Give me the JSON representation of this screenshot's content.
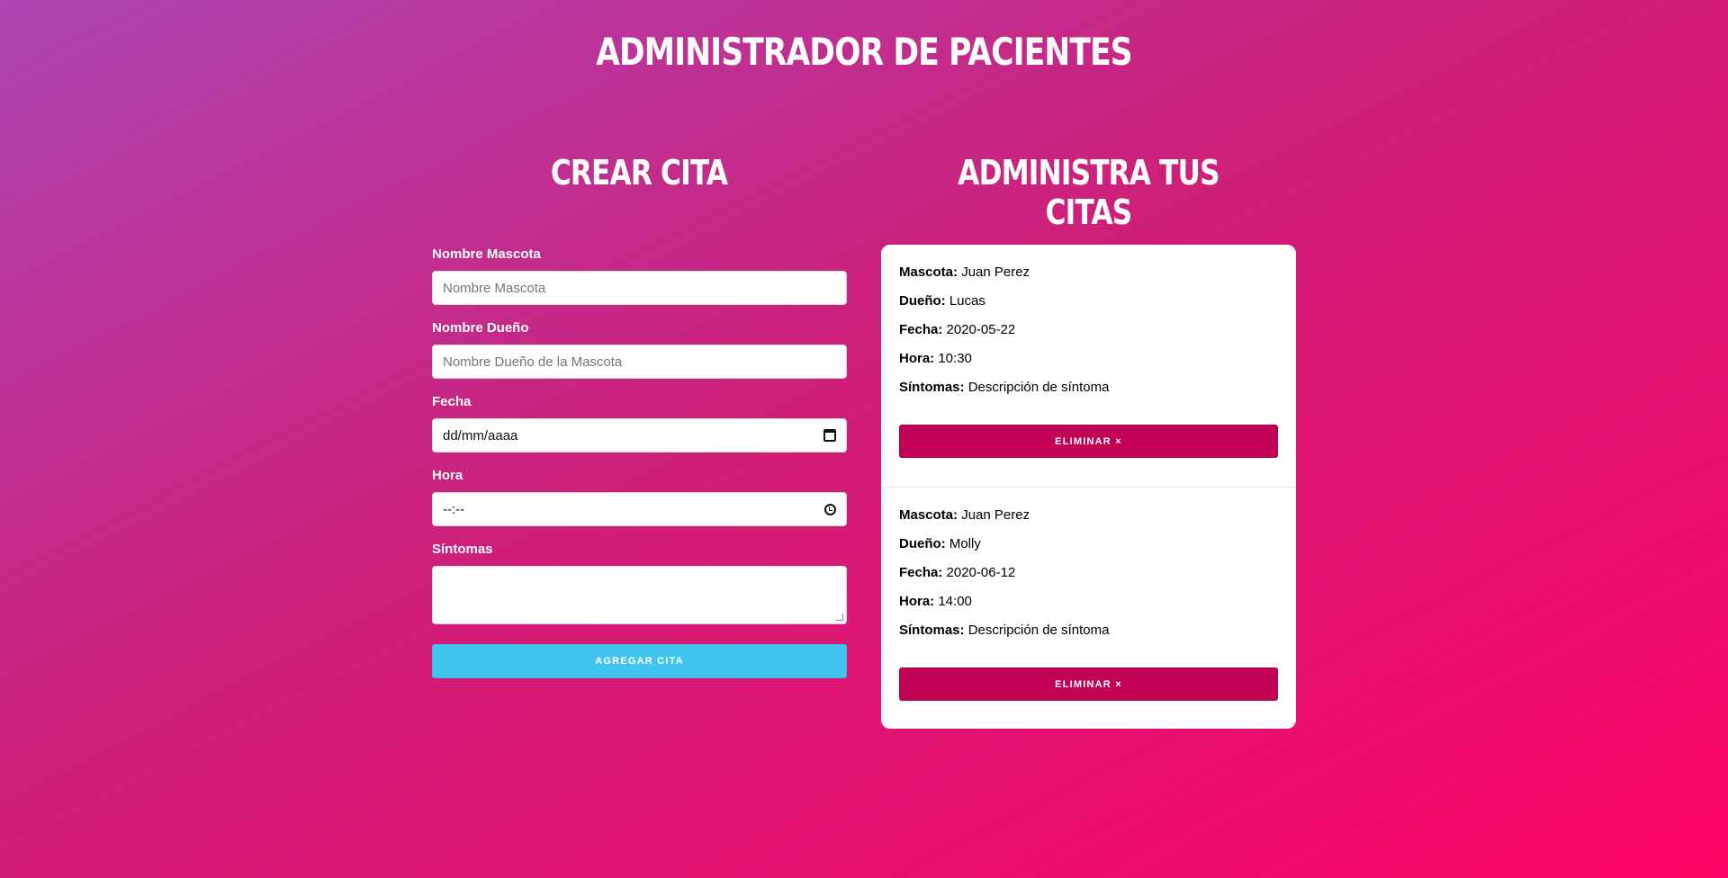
{
  "page": {
    "title": "Administrador de Pacientes"
  },
  "form": {
    "title": "Crear Cita",
    "fields": [
      {
        "label": "Nombre Mascota",
        "placeholder": "Nombre Mascota",
        "value": ""
      },
      {
        "label": "Nombre Dueño",
        "placeholder": "Nombre Dueño de la Mascota",
        "value": ""
      },
      {
        "label": "Fecha",
        "value": "dd/mm/aaaa",
        "icon": "calendar-icon"
      },
      {
        "label": "Hora",
        "value": "--:--",
        "icon": "clock-icon"
      },
      {
        "label": "Síntomas",
        "value": ""
      }
    ],
    "submit_label": "Agregar Cita"
  },
  "list": {
    "title": "Administra tus Citas",
    "labels": {
      "mascota": "Mascota:",
      "dueno": "Dueño:",
      "fecha": "Fecha:",
      "hora": "Hora:",
      "sintomas": "Síntomas:"
    },
    "delete_label": "Eliminar ×",
    "citas": [
      {
        "mascota": "Juan Perez",
        "dueno": "Lucas",
        "fecha": "2020-05-22",
        "hora": "10:30",
        "sintomas": "Descripción de síntoma"
      },
      {
        "mascota": "Juan Perez",
        "dueno": "Molly",
        "fecha": "2020-06-12",
        "hora": "14:00",
        "sintomas": "Descripción de síntoma"
      }
    ]
  },
  "colors": {
    "submit": "#41c5ef",
    "delete": "#c20355",
    "gradient_start": "#ad45b2",
    "gradient_end": "#fd0566"
  }
}
